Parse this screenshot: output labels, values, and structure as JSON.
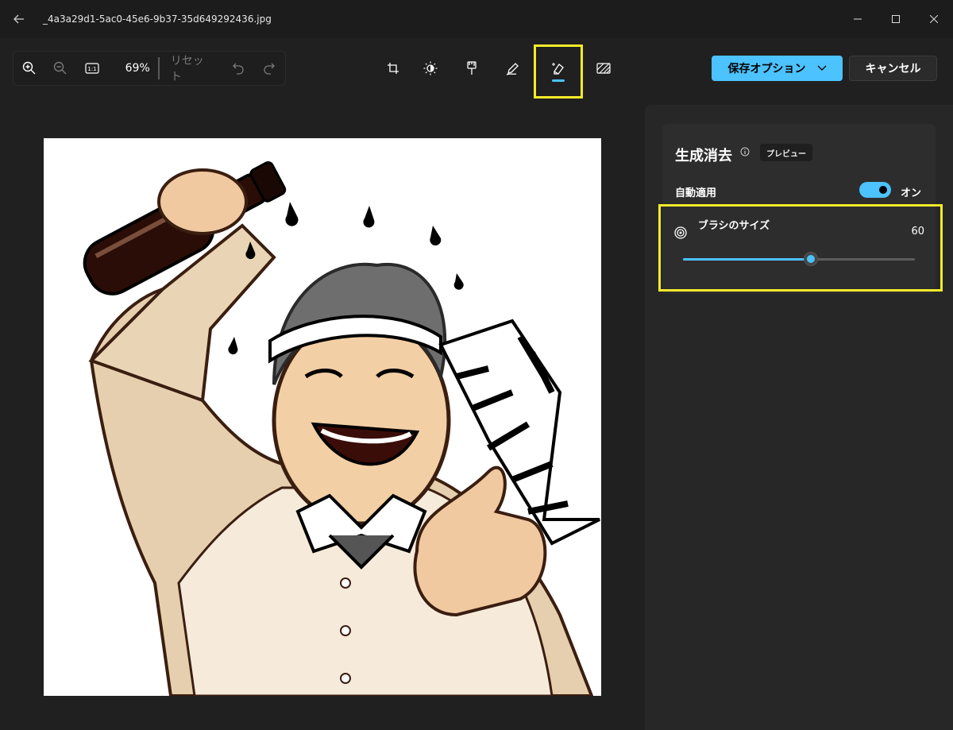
{
  "window": {
    "title": "_4a3a29d1-5ac0-45e6-9b37-35d649292436.jpg",
    "back_icon": "arrow-left-icon",
    "controls": [
      "minimize-icon",
      "maximize-icon",
      "close-icon"
    ]
  },
  "toolbar": {
    "zoom_in_icon": "zoom-in-icon",
    "zoom_out_icon": "zoom-out-icon",
    "actual_size_label": "1:1",
    "zoom_level": "69%",
    "reset_label": "リセット",
    "undo_icon": "undo-icon",
    "redo_icon": "redo-icon",
    "tools": [
      {
        "icon": "crop-icon",
        "active": false
      },
      {
        "icon": "brightness-icon",
        "active": false
      },
      {
        "icon": "filter-icon",
        "active": false
      },
      {
        "icon": "markup-pen-icon",
        "active": false
      },
      {
        "icon": "generative-erase-icon",
        "active": true
      },
      {
        "icon": "background-icon",
        "active": false
      }
    ],
    "save_label": "保存オプション",
    "cancel_label": "キャンセル"
  },
  "panel": {
    "title": "生成消去",
    "badge": "プレビュー",
    "auto_apply_label": "自動適用",
    "auto_apply_state": "オン",
    "auto_apply_on": true,
    "brush_size_label": "ブラシのサイズ",
    "brush_size_value": "60",
    "brush_slider_fraction": 0.55
  },
  "colors": {
    "accent": "#4cc2ff",
    "highlight": "#f5ea2a",
    "background": "#202020",
    "panel": "#272727"
  },
  "canvas": {
    "image_subject": "illustration of laughing man holding bottle giving thumbs up"
  }
}
